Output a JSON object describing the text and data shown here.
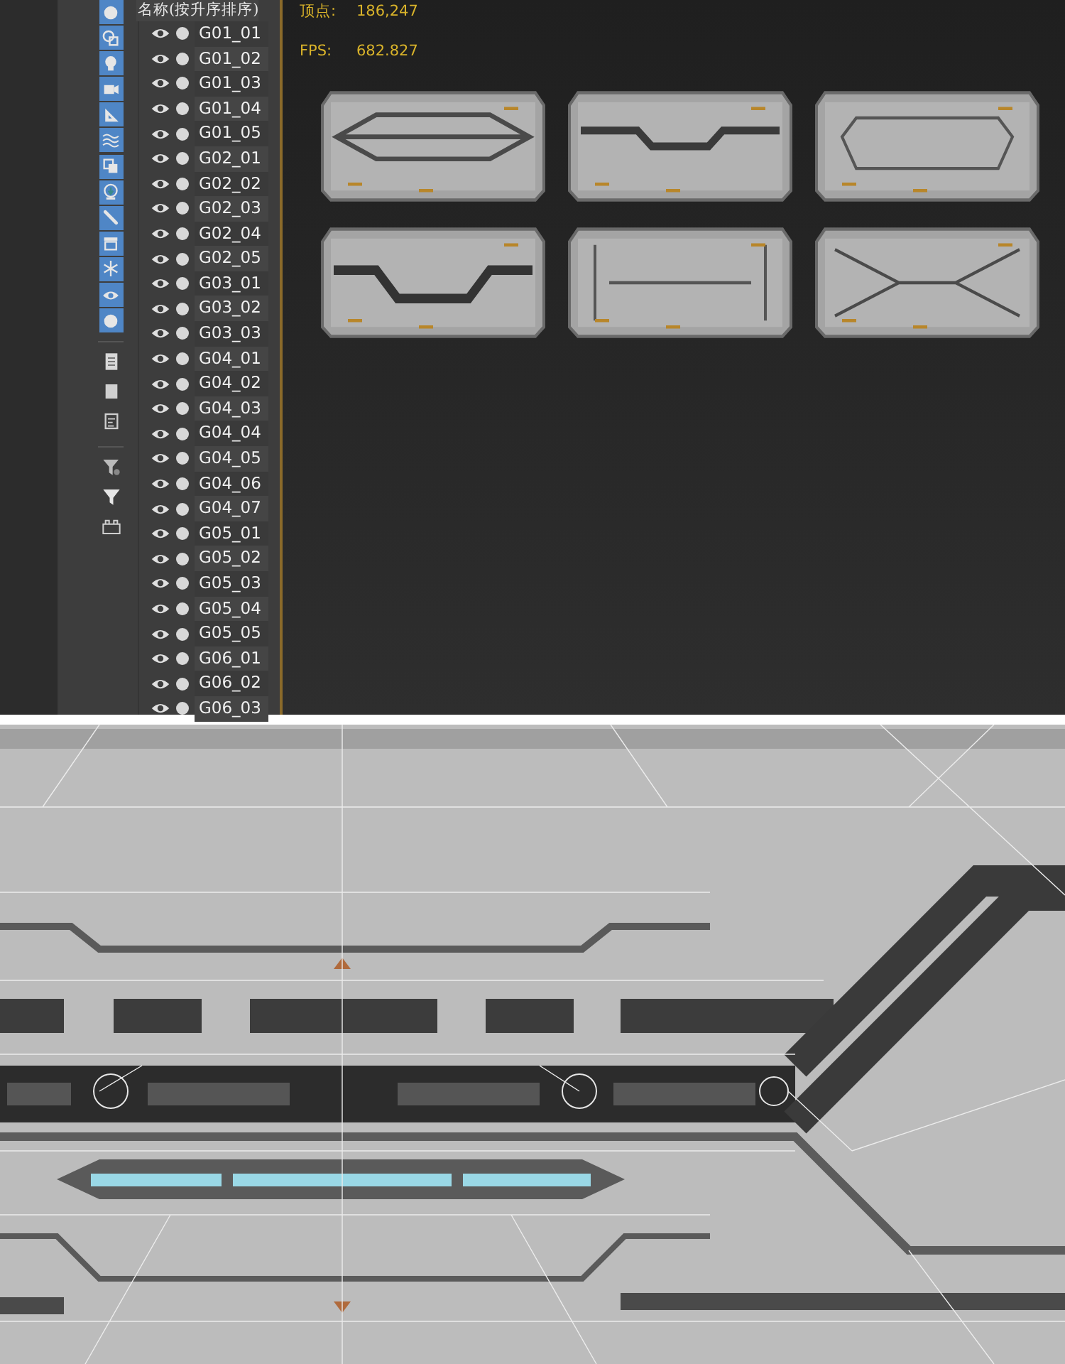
{
  "scene_explorer": {
    "column_header": "名称(按升序排序)",
    "filter_toggles": [
      {
        "on": true
      },
      {
        "on": true
      },
      {
        "on": true
      },
      {
        "on": true
      },
      {
        "on": true
      },
      {
        "on": true
      },
      {
        "on": true
      },
      {
        "on": true
      },
      {
        "on": true
      },
      {
        "on": true
      },
      {
        "on": true
      },
      {
        "on": true
      },
      {
        "on": true
      }
    ],
    "objects": [
      {
        "name": "G01_01",
        "visible": true
      },
      {
        "name": "G01_02",
        "visible": true
      },
      {
        "name": "G01_03",
        "visible": true
      },
      {
        "name": "G01_04",
        "visible": true
      },
      {
        "name": "G01_05",
        "visible": true
      },
      {
        "name": "G02_01",
        "visible": true
      },
      {
        "name": "G02_02",
        "visible": true
      },
      {
        "name": "G02_03",
        "visible": true
      },
      {
        "name": "G02_04",
        "visible": true
      },
      {
        "name": "G02_05",
        "visible": true
      },
      {
        "name": "G03_01",
        "visible": true
      },
      {
        "name": "G03_02",
        "visible": true
      },
      {
        "name": "G03_03",
        "visible": true
      },
      {
        "name": "G04_01",
        "visible": true
      },
      {
        "name": "G04_02",
        "visible": true
      },
      {
        "name": "G04_03",
        "visible": true
      },
      {
        "name": "G04_04",
        "visible": true
      },
      {
        "name": "G04_05",
        "visible": true
      },
      {
        "name": "G04_06",
        "visible": true
      },
      {
        "name": "G04_07",
        "visible": true
      },
      {
        "name": "G05_01",
        "visible": true
      },
      {
        "name": "G05_02",
        "visible": true
      },
      {
        "name": "G05_03",
        "visible": true
      },
      {
        "name": "G05_04",
        "visible": true
      },
      {
        "name": "G05_05",
        "visible": true
      },
      {
        "name": "G06_01",
        "visible": true
      },
      {
        "name": "G06_02",
        "visible": true
      },
      {
        "name": "G06_03",
        "visible": true
      }
    ]
  },
  "viewport": {
    "stats": [
      {
        "label": "顶点:",
        "value": "186,247"
      },
      {
        "label": "FPS:",
        "value": "682.827"
      }
    ]
  }
}
